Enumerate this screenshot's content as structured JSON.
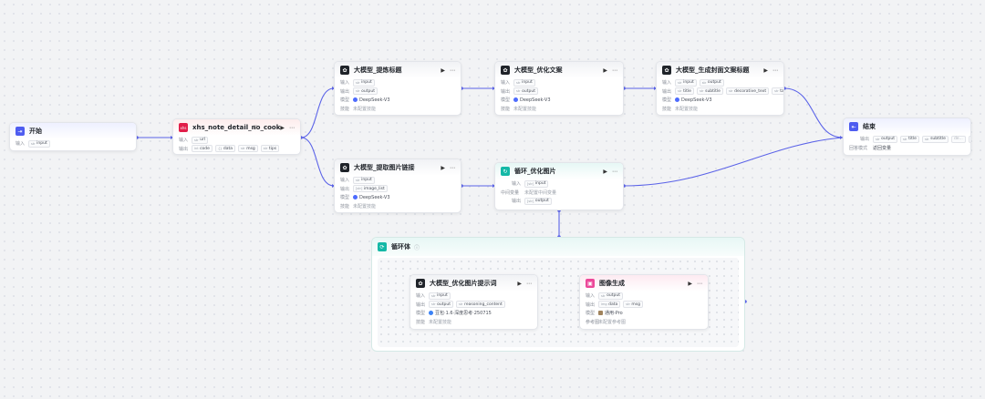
{
  "colors": {
    "accent": "#4e5cf0",
    "loop": "#14b8a6",
    "image": "#ec4899"
  },
  "common": {
    "play": "▶",
    "more": "⋯",
    "input_label": "输入",
    "output_label": "输出",
    "model_label": "模型",
    "skill_label": "技能",
    "skill_unset": "未配置技能",
    "type_str": "str",
    "type_arr_str": "[str]"
  },
  "start": {
    "title": "开始",
    "icon": "start-icon",
    "input_label": "输入",
    "input_tag": "input"
  },
  "xhs": {
    "title": "xhs_note_detail_no_cookie",
    "badge_icon": "doc-icon",
    "input_label": "输入",
    "input_tag": "url",
    "output_label": "输出",
    "outputs": [
      "code",
      "data",
      "msg",
      "tips"
    ]
  },
  "llm_title": {
    "title": "大模型_提炼标题",
    "input_tag": "input",
    "output_tag": "output",
    "model": "DeepSeek-V3"
  },
  "llm_copy": {
    "title": "大模型_优化文案",
    "input_tag": "input",
    "output_tag": "output",
    "model": "DeepSeek-V3"
  },
  "llm_cover": {
    "title": "大模型_生成封面文案标题",
    "inputs": [
      "input",
      "output"
    ],
    "outputs": [
      "title",
      "subtitle",
      "decorative_text",
      "tags"
    ],
    "model": "DeepSeek-V3"
  },
  "llm_link": {
    "title": "大模型_提取图片链接",
    "input_tag": "input",
    "output_tag": "image_list",
    "model": "DeepSeek-V3"
  },
  "loop_node": {
    "title": "循环_优化图片",
    "input_tag": "input",
    "mid_label": "中间变量",
    "mid_value": "未配置中间变量",
    "output_tag": "output"
  },
  "end": {
    "title": "结束",
    "output_label": "输出",
    "outputs": [
      "output",
      "title",
      "subtitle",
      "de..."
    ],
    "more_count": "...",
    "mode_label": "回答模式",
    "mode_value": "返回变量"
  },
  "loop_body": {
    "title": "循环体",
    "info": "ⓘ"
  },
  "llm_prompt": {
    "title": "大模型_优化图片提示词",
    "input_tag": "input",
    "outputs": [
      "output",
      "reasoning_content"
    ],
    "model": "豆包·1.6·深度思考·250715"
  },
  "imggen": {
    "title": "图像生成",
    "input_tag": "output",
    "outputs": [
      "data",
      "msg"
    ],
    "model": "通用-Pro",
    "ref_label": "参考图",
    "ref_value": "未配置参考图"
  }
}
